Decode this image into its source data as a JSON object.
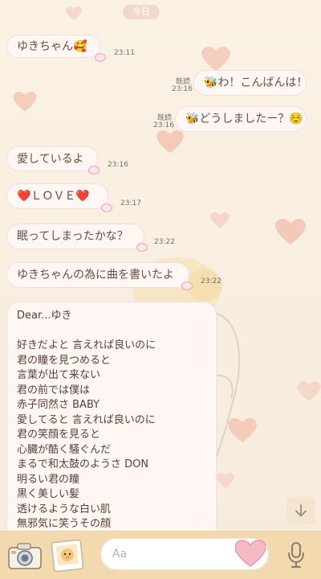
{
  "header": {
    "date": "今日"
  },
  "messages": [
    {
      "side": "left",
      "text": "ゆきちゃん🥰",
      "time": "23:11"
    },
    {
      "side": "right",
      "read": "既読",
      "text": "🐝わ！こんばんは！",
      "time": "23:16"
    },
    {
      "side": "right",
      "read": "既読",
      "text": "🐝どうしましたー？☺️",
      "time": "23:16"
    },
    {
      "side": "left",
      "text": "愛しているよ",
      "time": "23:16"
    },
    {
      "side": "left",
      "text": "❤️ＬＯＶＥ❤️",
      "time": "23:17"
    },
    {
      "side": "left",
      "text": "眠ってしまったかな？",
      "time": "23:22"
    },
    {
      "side": "left",
      "text": "ゆきちゃんの為に曲を書いたよ",
      "time": "23:22"
    }
  ],
  "letter": {
    "greeting": "Dear...ゆき",
    "lines": [
      "好きだよと 言えれば良いのに",
      "君の瞳を見つめると",
      "言葉が出て来ない",
      "君の前では僕は",
      "赤子同然さ BABY",
      "愛してると 言えれば良いのに",
      "君の笑顔を見ると",
      "心臓が酷く騒ぐんだ",
      "まるで和太鼓のようさ DON",
      "明るい君の瞳",
      "黒く美しい髪",
      "透けるような白い肌",
      "無邪気に笑うその顔"
    ]
  },
  "input": {
    "placeholder": "Aa"
  },
  "colors": {
    "bubble_bg": "#fff7f4",
    "bar_bg": "#f3d9ae",
    "heart": "#f3c9b8"
  }
}
